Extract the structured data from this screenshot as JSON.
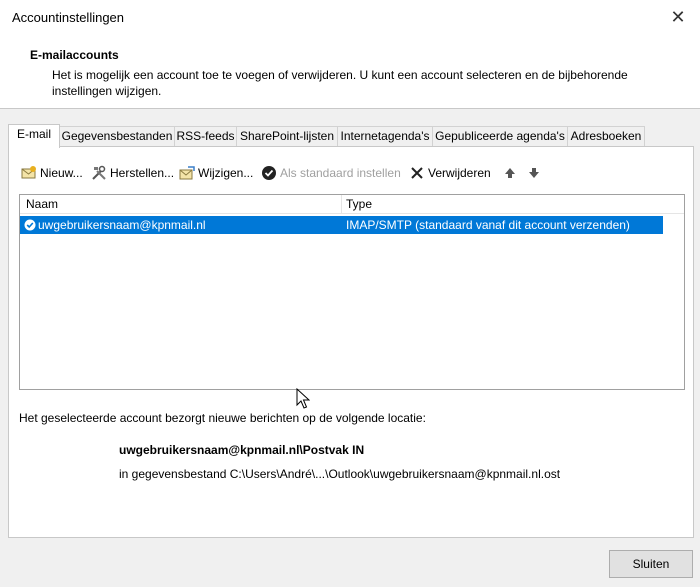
{
  "window": {
    "title": "Accountinstellingen"
  },
  "header": {
    "title": "E-mailaccounts",
    "description": "Het is mogelijk een account toe te voegen of verwijderen. U kunt een account selecteren en de bijbehorende instellingen wijzigen."
  },
  "tabs": [
    {
      "label": "E-mail",
      "active": true
    },
    {
      "label": "Gegevensbestanden"
    },
    {
      "label": "RSS-feeds"
    },
    {
      "label": "SharePoint-lijsten"
    },
    {
      "label": "Internetagenda's"
    },
    {
      "label": "Gepubliceerde agenda's"
    },
    {
      "label": "Adresboeken"
    }
  ],
  "toolbar": {
    "new": "Nieuw...",
    "repair": "Herstellen...",
    "change": "Wijzigen...",
    "set_default": "Als standaard instellen",
    "remove": "Verwijderen"
  },
  "list": {
    "col_name": "Naam",
    "col_type": "Type",
    "rows": [
      {
        "name": "uwgebruikersnaam@kpnmail.nl",
        "type": "IMAP/SMTP (standaard vanaf dit account verzenden)"
      }
    ]
  },
  "info": {
    "text": "Het geselecteerde account bezorgt nieuwe berichten op de volgende locatie:",
    "location": "uwgebruikersnaam@kpnmail.nl\\Postvak IN",
    "file": "in gegevensbestand C:\\Users\\André\\...\\Outlook\\uwgebruikersnaam@kpnmail.nl.ost"
  },
  "buttons": {
    "close": "Sluiten"
  },
  "colors": {
    "selection": "#0078d7"
  }
}
